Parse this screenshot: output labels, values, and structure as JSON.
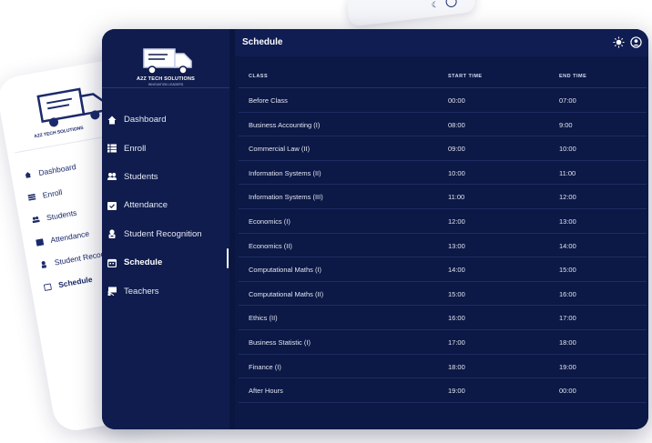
{
  "background_sidebar": {
    "brand": "A2Z TECH SOLUTIONS",
    "items": [
      {
        "label": "Dashboard",
        "icon": "home-icon"
      },
      {
        "label": "Enroll",
        "icon": "list-icon"
      },
      {
        "label": "Students",
        "icon": "people-icon"
      },
      {
        "label": "Attendance",
        "icon": "calendar-check-icon"
      },
      {
        "label": "Student Recogn",
        "icon": "award-icon"
      },
      {
        "label": "Schedule",
        "icon": "calendar-icon",
        "active": true
      }
    ]
  },
  "sidebar": {
    "brand": "A2Z TECH SOLUTIONS",
    "tagline": "INNOVATION LEADERS",
    "items": [
      {
        "label": "Dashboard",
        "icon": "home-icon"
      },
      {
        "label": "Enroll",
        "icon": "list-icon"
      },
      {
        "label": "Students",
        "icon": "people-icon"
      },
      {
        "label": "Attendance",
        "icon": "calendar-check-icon"
      },
      {
        "label": "Student Recognition",
        "icon": "award-icon"
      },
      {
        "label": "Schedule",
        "icon": "calendar-icon",
        "active": true
      },
      {
        "label": "Teachers",
        "icon": "board-icon"
      }
    ]
  },
  "header": {
    "title": "Schedule",
    "theme_icon": "sun-icon",
    "account_icon": "account-icon"
  },
  "table": {
    "columns": [
      "CLASS",
      "START TIME",
      "END TIME"
    ],
    "rows": [
      [
        "Before Class",
        "00:00",
        "07:00"
      ],
      [
        "Business Accounting (I)",
        "08:00",
        "9:00"
      ],
      [
        "Commercial Law (II)",
        "09:00",
        "10:00"
      ],
      [
        "Information Systems (II)",
        "10:00",
        "11:00"
      ],
      [
        "Information Systems (III)",
        "11:00",
        "12:00"
      ],
      [
        "Economics (I)",
        "12:00",
        "13:00"
      ],
      [
        "Economics (II)",
        "13:00",
        "14:00"
      ],
      [
        "Computational Maths (I)",
        "14:00",
        "15:00"
      ],
      [
        "Computational Maths (II)",
        "15:00",
        "16:00"
      ],
      [
        "Ethics (II)",
        "16:00",
        "17:00"
      ],
      [
        "Business Statistic (I)",
        "17:00",
        "18:00"
      ],
      [
        "Finance (I)",
        "18:00",
        "19:00"
      ],
      [
        "After Hours",
        "19:00",
        "00:00"
      ]
    ]
  },
  "colors": {
    "sidebar_bg": "#0f1c4d",
    "content_bg": "#0c1845",
    "accent_text": "#ffffff"
  }
}
